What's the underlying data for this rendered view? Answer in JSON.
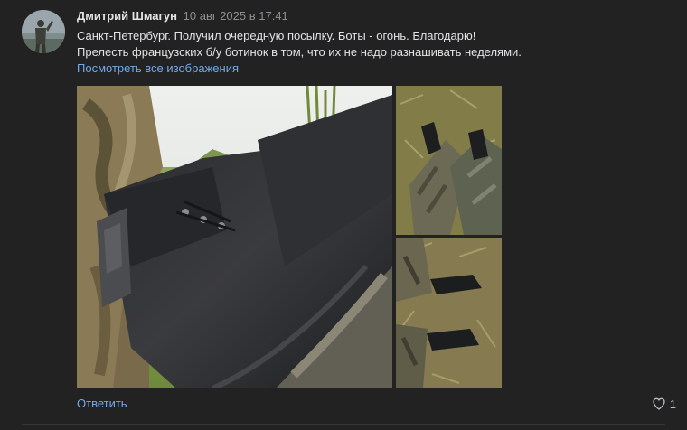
{
  "post": {
    "author": "Дмитрий Шмагун",
    "date": "10 авг 2025 в 17:41",
    "lines": [
      "Санкт-Петербург. Получил очередную посылку. Боты - огонь. Благодарю!",
      "Прелесть французских б/у ботинок в том, что их не надо разнашивать неделями."
    ],
    "show_all_label": "Посмотреть все изображения",
    "reply_label": "Ответить",
    "likes_count": "1"
  },
  "colors": {
    "background": "#222222",
    "link": "#71aaeb",
    "text": "#e1e3e6",
    "muted": "#8b8e93"
  },
  "icons": [
    "avatar",
    "heart-icon"
  ]
}
